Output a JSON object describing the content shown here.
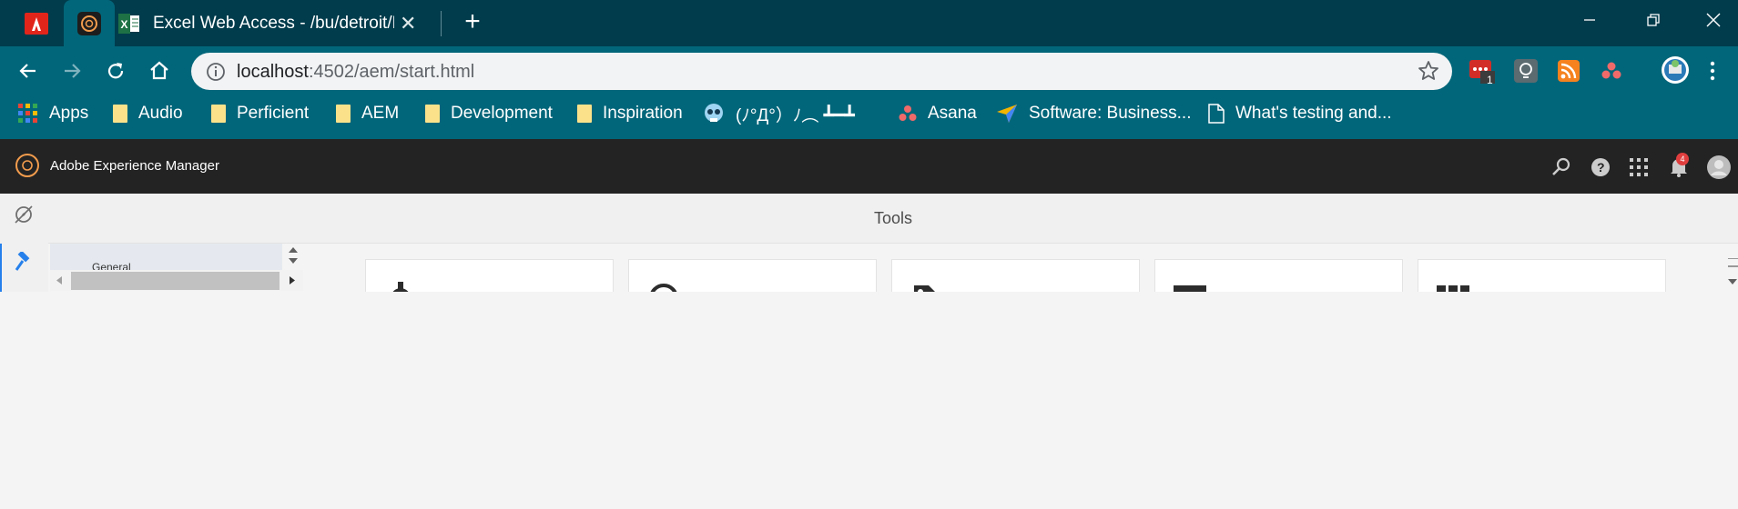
{
  "browser": {
    "tabs": [
      {
        "icon": "adobe-icon"
      },
      {
        "icon": "aem-icon"
      },
      {
        "icon": "excel-icon",
        "title": "Excel Web Access - /bu/detroit/D"
      }
    ],
    "address": {
      "host": "localhost",
      "path": ":4502/aem/start.html"
    },
    "extension_badge": "1",
    "bookmarks": [
      {
        "label": "Apps",
        "icon": "apps-grid-icon"
      },
      {
        "label": "Audio",
        "icon": "folder-icon"
      },
      {
        "label": "Perficient",
        "icon": "folder-icon"
      },
      {
        "label": "AEM",
        "icon": "folder-icon"
      },
      {
        "label": "Development",
        "icon": "folder-icon"
      },
      {
        "label": "Inspiration",
        "icon": "folder-icon"
      },
      {
        "label": "(ﾉ°Д°）ﾉ︵ ┻━┻",
        "icon": "skull-icon"
      },
      {
        "label": "Asana",
        "icon": "asana-icon"
      },
      {
        "label": "Software: Business...",
        "icon": "paper-plane-icon"
      },
      {
        "label": "What's testing and...",
        "icon": "page-icon"
      }
    ]
  },
  "aem": {
    "app_title": "Adobe Experience Manager",
    "notification_count": "4",
    "page_title": "Tools",
    "category_item": "General",
    "colors": {
      "header": "#232323",
      "accent": "#2680eb",
      "tab_strip": "#003c4c",
      "toolbar": "#02667a"
    }
  }
}
